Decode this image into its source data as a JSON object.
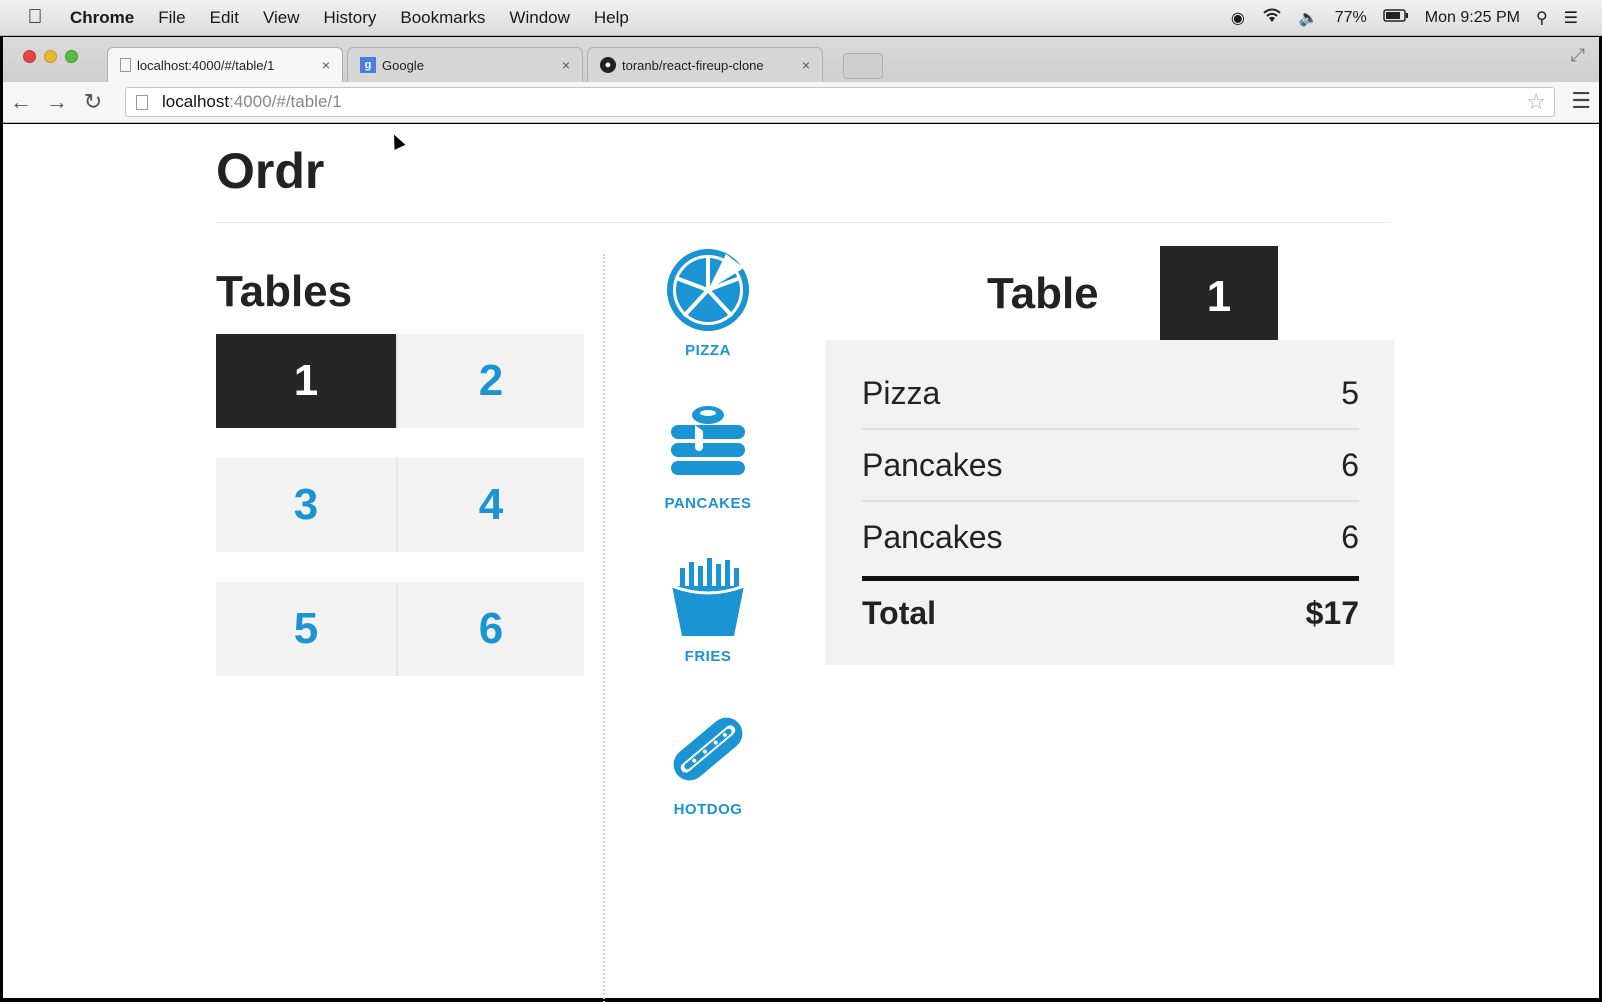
{
  "menubar": {
    "items": [
      "Chrome",
      "File",
      "Edit",
      "View",
      "History",
      "Bookmarks",
      "Window",
      "Help"
    ],
    "battery": "77%",
    "clock": "Mon 9:25 PM"
  },
  "tabs": [
    {
      "title": "localhost:4000/#/table/1",
      "close": "×"
    },
    {
      "title": "Google",
      "close": "×"
    },
    {
      "title": "toranb/react-fireup-clone",
      "close": "×"
    }
  ],
  "address": {
    "host": "localhost",
    "path": ":4000/#/table/1"
  },
  "app": {
    "title": "Ordr"
  },
  "tables": {
    "heading": "Tables",
    "numbers": [
      "1",
      "2",
      "3",
      "4",
      "5",
      "6"
    ],
    "selected": "1"
  },
  "menu": [
    {
      "label": "PIZZA",
      "icon": "pizza-icon"
    },
    {
      "label": "PANCAKES",
      "icon": "pancakes-icon"
    },
    {
      "label": "FRIES",
      "icon": "fries-icon"
    },
    {
      "label": "HOTDOG",
      "icon": "hotdog-icon"
    }
  ],
  "order": {
    "heading": "Table",
    "table_number": "1",
    "items": [
      {
        "name": "Pizza",
        "price": "5"
      },
      {
        "name": "Pancakes",
        "price": "6"
      },
      {
        "name": "Pancakes",
        "price": "6"
      }
    ],
    "total_label": "Total",
    "total_value": "$17"
  },
  "colors": {
    "accent": "#1a94d2",
    "dark": "#262626",
    "panel": "#f2f2f2"
  }
}
